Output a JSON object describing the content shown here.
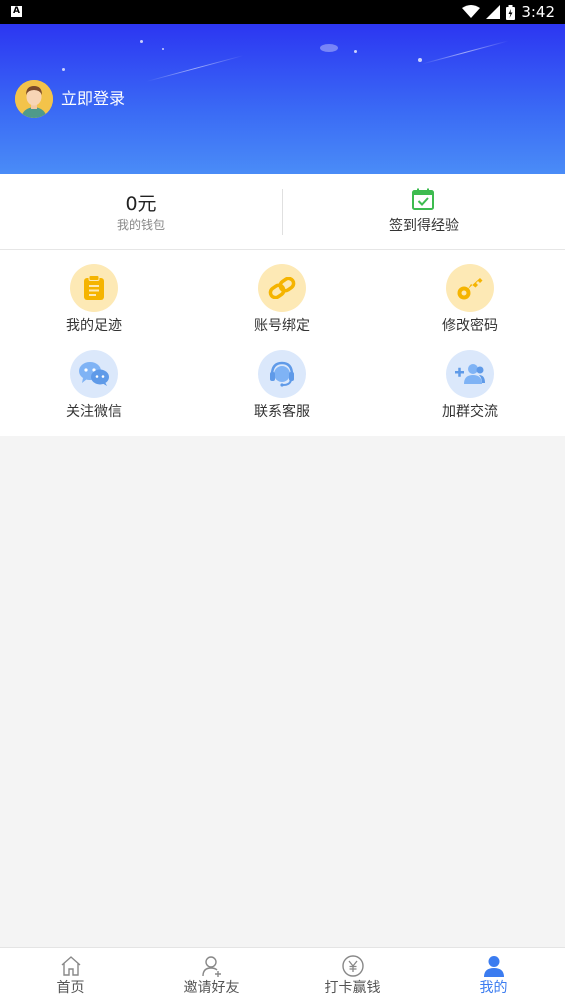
{
  "status_bar": {
    "time": "3:42",
    "app_badge": "A"
  },
  "header": {
    "login_text": "立即登录"
  },
  "wallet": {
    "amount": "0元",
    "label": "我的钱包"
  },
  "checkin": {
    "label": "签到得经验"
  },
  "menu": {
    "items": [
      {
        "label": "我的足迹",
        "icon": "clipboard-icon"
      },
      {
        "label": "账号绑定",
        "icon": "link-icon"
      },
      {
        "label": "修改密码",
        "icon": "key-icon"
      },
      {
        "label": "关注微信",
        "icon": "wechat-icon"
      },
      {
        "label": "联系客服",
        "icon": "headset-icon"
      },
      {
        "label": "加群交流",
        "icon": "add-group-icon"
      }
    ]
  },
  "bottom_nav": {
    "items": [
      {
        "label": "首页",
        "icon": "home-icon"
      },
      {
        "label": "邀请好友",
        "icon": "invite-user-icon"
      },
      {
        "label": "打卡赢钱",
        "icon": "yen-coin-icon"
      },
      {
        "label": "我的",
        "icon": "profile-icon",
        "active": true
      }
    ]
  },
  "colors": {
    "header_top": "#2c36f2",
    "header_bottom": "#4a8cf7",
    "accent": "#3b7cf0",
    "icon_yellow_bg": "#fde9b5",
    "icon_yellow_fg": "#f5b400",
    "icon_blue_bg": "#dbe8fb",
    "icon_blue_fg": "#6aa3f0",
    "checkin_green": "#3dbb4f"
  }
}
